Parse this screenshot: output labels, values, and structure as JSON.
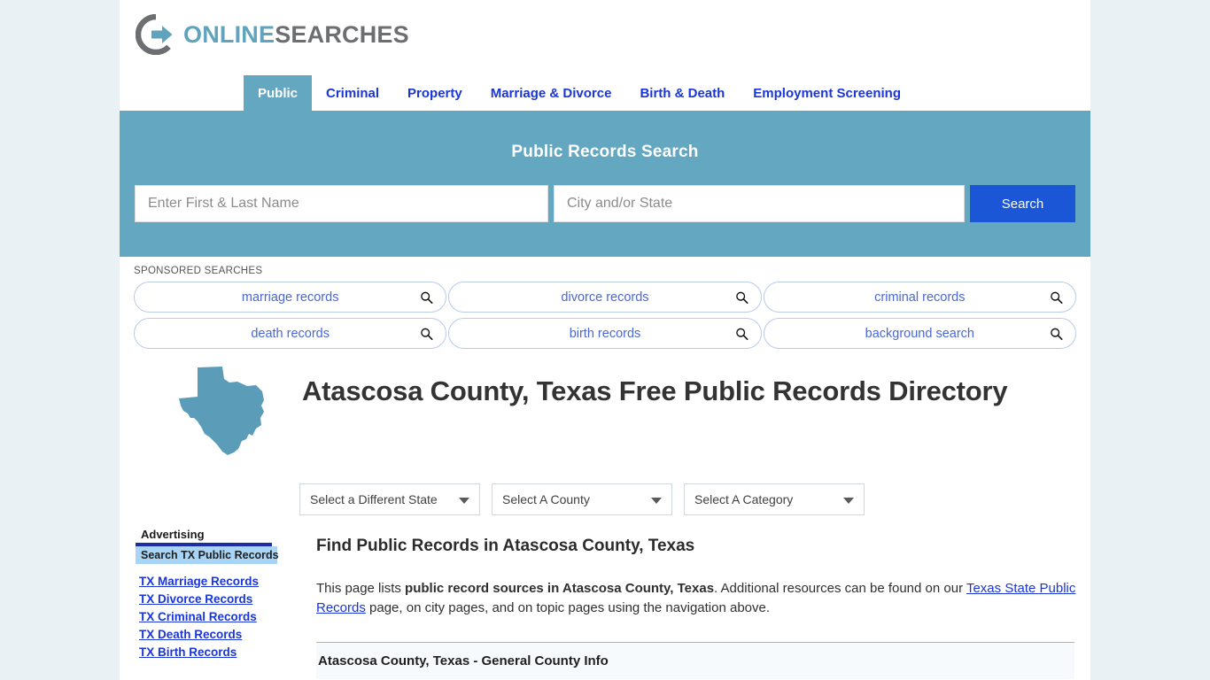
{
  "brand": {
    "name_part1": "ONLINE",
    "name_part2": "SEARCHES",
    "logo_icon": "circle-arrow-logo-icon",
    "teal": "#64a7c0",
    "gray": "#6d6e71"
  },
  "nav": {
    "items": [
      {
        "label": "Public",
        "active": true
      },
      {
        "label": "Criminal",
        "active": false
      },
      {
        "label": "Property",
        "active": false
      },
      {
        "label": "Marriage & Divorce",
        "active": false
      },
      {
        "label": "Birth & Death",
        "active": false
      },
      {
        "label": "Employment Screening",
        "active": false
      }
    ]
  },
  "search": {
    "title": "Public Records Search",
    "name_placeholder": "Enter First & Last Name",
    "name_value": "",
    "city_placeholder": "City and/or State",
    "city_value": "",
    "button_label": "Search",
    "button_color": "#1a56d6",
    "band_color": "#64a7c0"
  },
  "sponsored": {
    "label": "SPONSORED SEARCHES",
    "icon": "magnifier-icon",
    "rows": [
      [
        "marriage records",
        "divorce records",
        "criminal records"
      ],
      [
        "death records",
        "birth records",
        "background search"
      ]
    ]
  },
  "hero": {
    "state_map_icon": "texas-state-map-icon",
    "title": "Atascosa County, Texas Free Public Records Directory"
  },
  "filters": {
    "state": "Select a Different State",
    "county": "Select A County",
    "category": "Select A Category",
    "caret_icon": "chevron-down-icon"
  },
  "sidebar": {
    "advertising_label": "Advertising",
    "banner_label": "Search TX Public Records",
    "links": [
      "TX Marriage Records",
      "TX Divorce Records",
      "TX Criminal Records",
      "TX Death Records",
      "TX Birth Records"
    ]
  },
  "main": {
    "heading": "Find Public Records in Atascosa County, Texas",
    "intro_part1": "This page lists ",
    "intro_bold": "public record sources in Atascosa County, Texas",
    "intro_part2": ". Additional resources can be found on our ",
    "intro_link": "Texas State Public Records",
    "intro_part3": " page, on city pages, and on topic pages using the navigation above.",
    "section_heading": "Atascosa County, Texas - General County Info"
  }
}
